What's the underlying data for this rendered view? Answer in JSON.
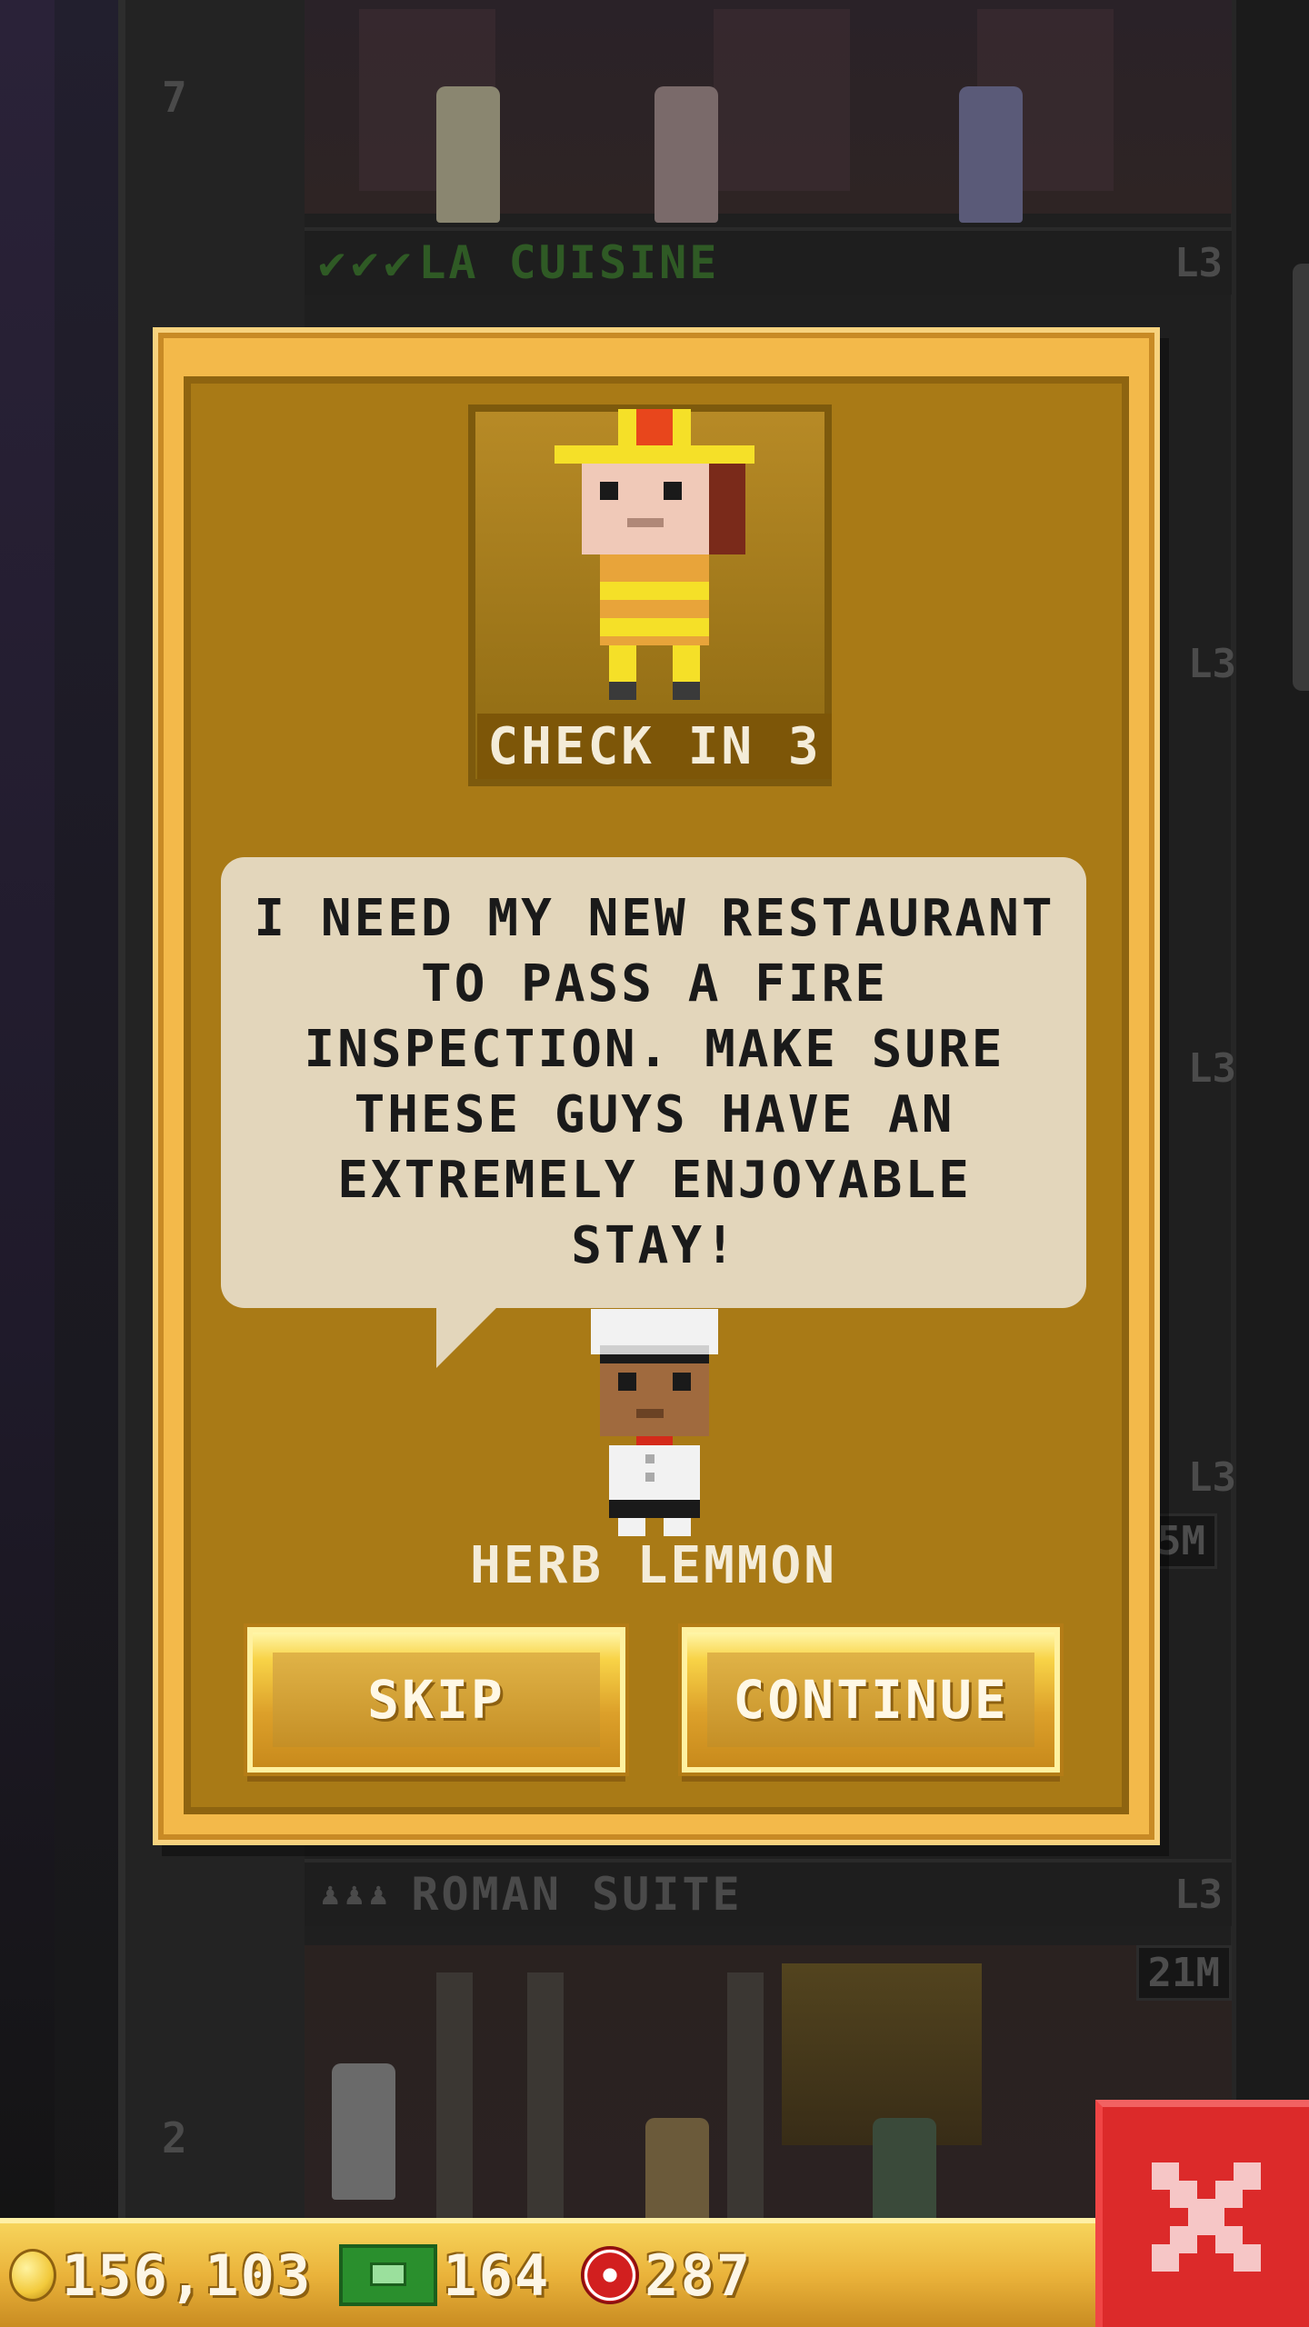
{
  "background": {
    "top_floor": {
      "name": "LA CUISINE",
      "level": "L3",
      "checks": [
        "✔",
        "✔",
        "✔"
      ],
      "floor_number": "7"
    },
    "bottom_floor": {
      "name": "ROMAN SUITE",
      "level": "L3",
      "price": "21M",
      "floor_number": "2",
      "people_icons": "♟♟♟"
    },
    "side_labels": [
      "L3",
      "L3",
      "L3"
    ],
    "side_price": "5M"
  },
  "dialog": {
    "caption": "CHECK IN 3",
    "message": "I NEED MY NEW RESTAURANT TO PASS A FIRE INSPECTION. MAKE SURE THESE GUYS HAVE AN EXTREMELY ENJOYABLE STAY!",
    "npc_name": "HERB LEMMON",
    "skip_label": "SKIP",
    "continue_label": "CONTINUE"
  },
  "hud": {
    "coins": "156,103",
    "bux": "164",
    "chips": "287"
  },
  "colors": {
    "dialog_outer": "#f3b94a",
    "dialog_inner": "#a97a16",
    "speech_bubble": "#e3d6bb",
    "close_button": "#dc2a2a",
    "check_green": "#2f5a25"
  },
  "icons": {
    "coin": "coin-icon",
    "bux": "bux-icon",
    "chip": "chip-icon",
    "close": "close-icon"
  }
}
